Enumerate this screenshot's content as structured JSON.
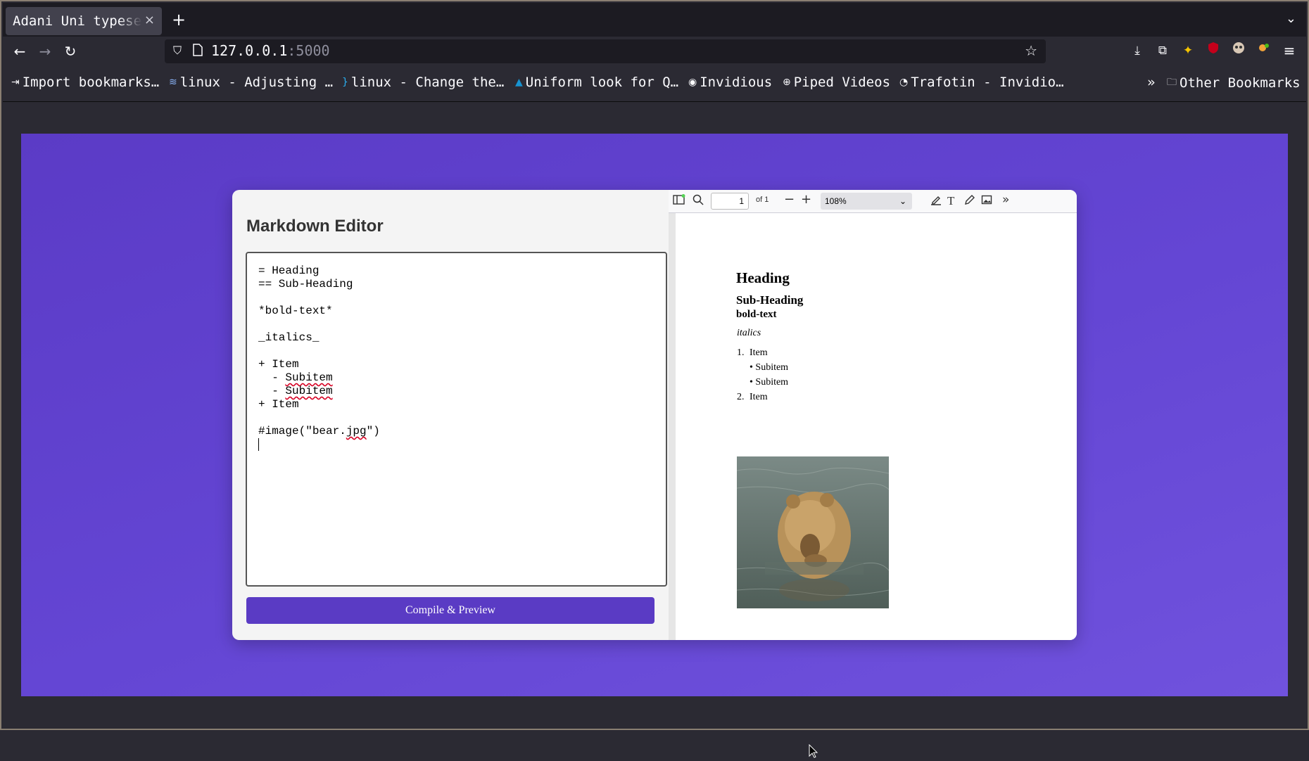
{
  "browser": {
    "tab_title": "Adani Uni typeset",
    "tab_close": "×",
    "new_tab": "+",
    "tab_list": "⌄",
    "url_host": "127.0.0.1",
    "url_port": ":5000",
    "bookmarks": [
      {
        "label": "Import bookmarks…",
        "icon": "import-icon"
      },
      {
        "label": "linux - Adjusting …",
        "icon": "stackexchange-icon"
      },
      {
        "label": "linux - Change the…",
        "icon": "superuser-icon"
      },
      {
        "label": "Uniform look for Q…",
        "icon": "archlinux-icon"
      },
      {
        "label": "Invidious",
        "icon": "invidious-icon"
      },
      {
        "label": "Piped Videos",
        "icon": "globe-icon"
      },
      {
        "label": "Trafotin - Invidio…",
        "icon": "invidious-icon"
      }
    ],
    "bookmarks_overflow": "»",
    "other_bookmarks": "Other Bookmarks"
  },
  "editor": {
    "title": "Markdown Editor",
    "content": "= Heading\n== Sub-Heading\n\n*bold-text*\n\n_italics_\n\n+ Item\n  - Subitem\n  - Subitem\n+ Item\n\n#image(\"bear.jpg\")",
    "compile_label": "Compile & Preview"
  },
  "viewer": {
    "page_number": "1",
    "page_of": "of 1",
    "zoom": "108%",
    "heading": "Heading",
    "subheading": "Sub-Heading",
    "bold": "bold-text",
    "italics": "italics",
    "list": [
      {
        "marker": "1.",
        "label": "Item",
        "subitems": [
          "Subitem",
          "Subitem"
        ]
      },
      {
        "marker": "2.",
        "label": "Item",
        "subitems": []
      }
    ]
  },
  "colors": {
    "accent": "#5a3bc4",
    "stage_top": "#5b3bc6",
    "stage_bottom": "#7052dd",
    "chrome": "#2b2a33"
  }
}
